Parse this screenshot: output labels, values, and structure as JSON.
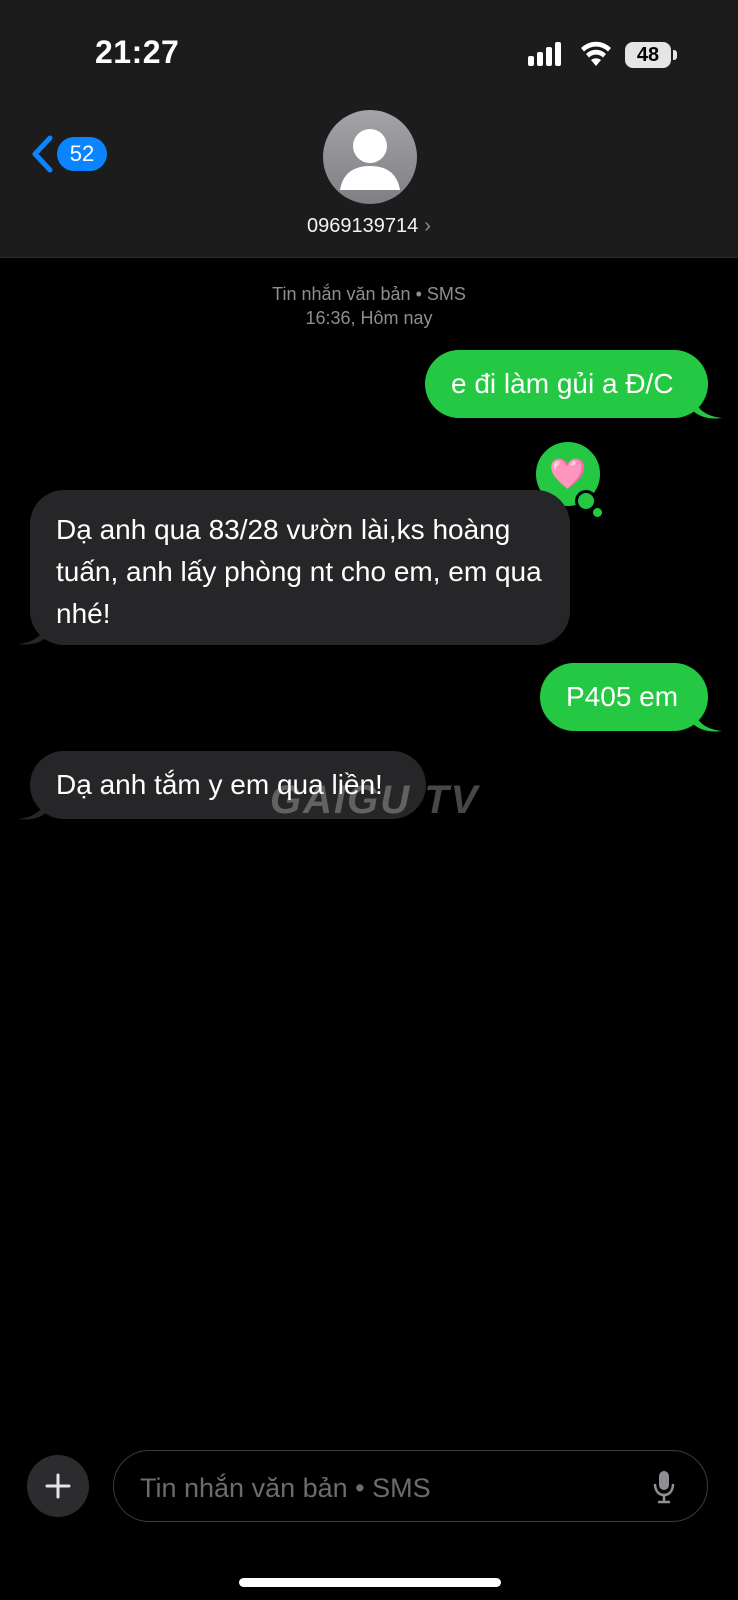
{
  "status_bar": {
    "time": "21:27",
    "battery": "48"
  },
  "header": {
    "back_count": "52",
    "contact": "0969139714"
  },
  "conversation": {
    "meta_line1": "Tin nhắn văn bản • SMS",
    "meta_line2": "16:36, Hôm nay",
    "messages": [
      {
        "direction": "outgoing",
        "text": "e đi làm gủi a Đ/C"
      },
      {
        "direction": "incoming",
        "text": "Dạ anh qua 83/28 vườn lài,ks hoàng tuấn, anh lấy phòng nt cho em, em qua nhé!"
      },
      {
        "direction": "outgoing",
        "text": "P405 em"
      },
      {
        "direction": "incoming",
        "text": "Dạ anh tắm y em qua liền!"
      }
    ],
    "reaction": "🩷"
  },
  "watermark": "GAIGU TV",
  "composer": {
    "placeholder": "Tin nhắn văn bản • SMS"
  },
  "colors": {
    "outgoing_bubble": "#25c842",
    "incoming_bubble": "#262628",
    "accent": "#0a84ff"
  }
}
